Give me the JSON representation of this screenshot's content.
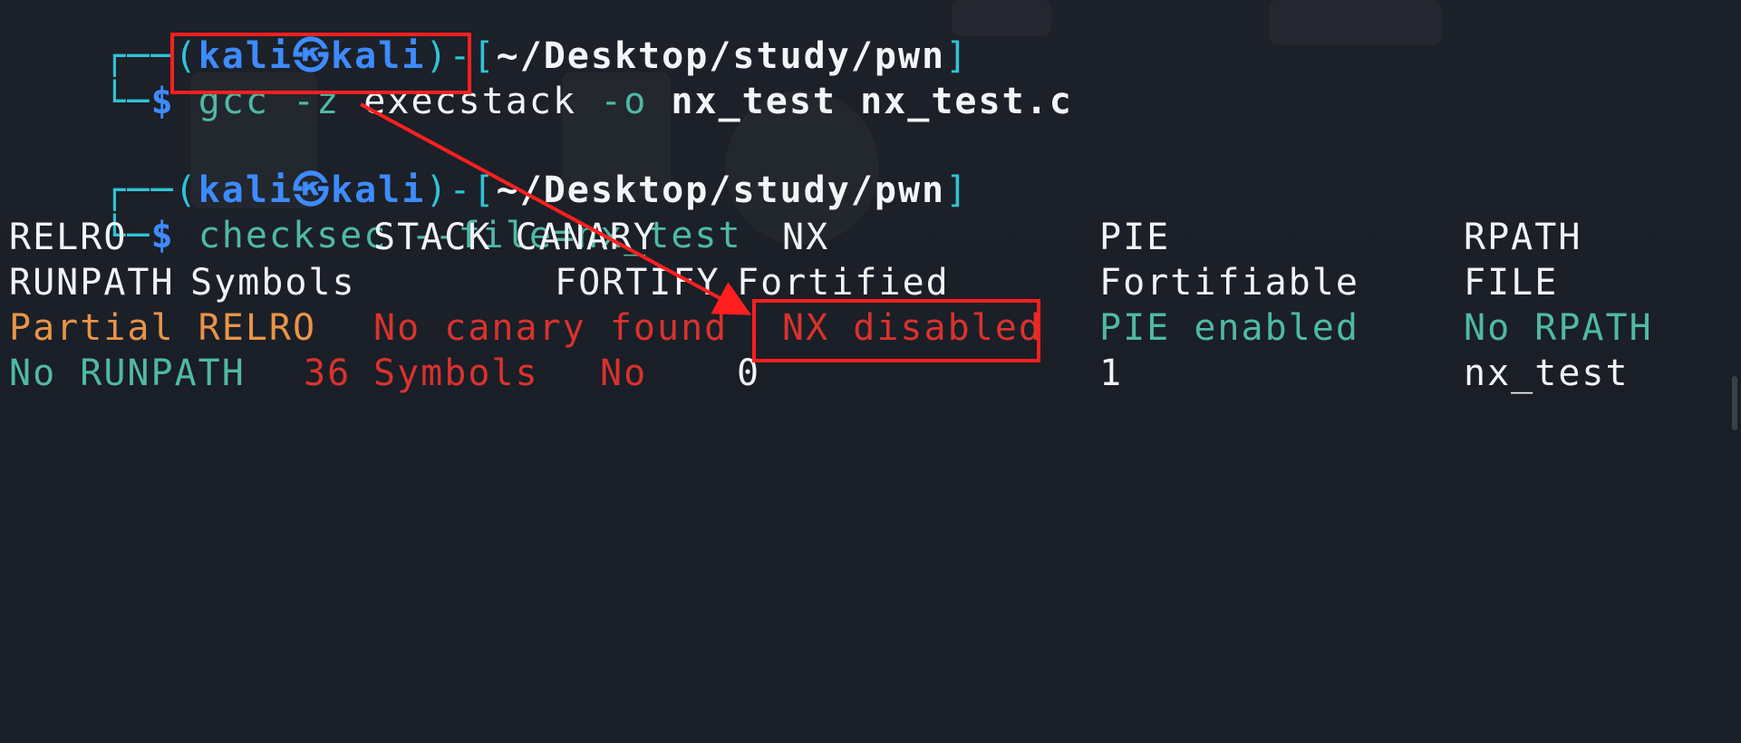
{
  "prompt1": {
    "corner": "┌──(",
    "user": "kali",
    "at": "㉿",
    "host": "kali",
    "close": ")-[",
    "path": "~/Desktop/study/pwn",
    "end": "]"
  },
  "command1": {
    "corner": "└─",
    "dollar": "$",
    "cmd": "gcc",
    "flag1": "-z",
    "flag1_arg": "execstack",
    "flag2": "-o",
    "output": "nx_test",
    "source": "nx_test.c"
  },
  "prompt2": {
    "corner": "┌──(",
    "user": "kali",
    "at": "㉿",
    "host": "kali",
    "close": ")-[",
    "path": "~/Desktop/study/pwn",
    "end": "]"
  },
  "command2": {
    "corner": "└─",
    "dollar": "$",
    "cmd": "checksec",
    "arg": "--file=nx_test"
  },
  "checksec": {
    "headers1": [
      "RELRO",
      "STACK CANARY",
      "NX",
      "PIE",
      "RPATH"
    ],
    "headers2": [
      "RUNPATH",
      "Symbols",
      "FORTIFY",
      "Fortified",
      "Fortifiable",
      "FILE"
    ],
    "values1": [
      "Partial RELRO",
      "No canary found",
      "NX disabled",
      "PIE enabled",
      "No RPATH"
    ],
    "values2": [
      "No RUNPATH",
      "36",
      "Symbols",
      "No",
      "0",
      "1",
      "nx_test"
    ]
  },
  "colors": {
    "background": "#1b1f27",
    "prompt_frame": "#2fc3d6",
    "user_host": "#3d8bff",
    "argument": "#4fb9a6",
    "warning": "#e89447",
    "danger": "#d9322e",
    "annotation": "#ff1f1f"
  }
}
